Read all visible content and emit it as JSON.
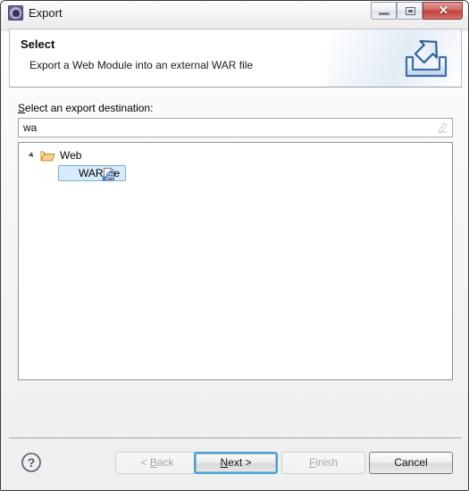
{
  "window": {
    "title": "Export",
    "icon": "eclipse-gear-icon",
    "controls": {
      "minimize": "minimize-icon",
      "maximize": "restore-icon",
      "close": "✕"
    }
  },
  "header": {
    "title": "Select",
    "subtitle": "Export a Web Module into an external WAR file",
    "icon": "export-arrow-icon"
  },
  "form": {
    "destination_label_mnemonic": "S",
    "destination_label_rest": "elect an export destination:",
    "destination_value": "wa",
    "destination_placeholder": "",
    "clear_icon": "clear-field-icon"
  },
  "tree": {
    "nodes": [
      {
        "label": "Web",
        "icon": "open-folder-icon",
        "expanded": true,
        "selected": false
      },
      {
        "label": "WAR file",
        "icon": "war-file-icon",
        "expanded": false,
        "selected": true
      }
    ]
  },
  "footer": {
    "help_icon": "help-question-icon",
    "buttons": [
      {
        "name": "back",
        "label_pre": "< ",
        "mnemonic": "B",
        "label_post": "ack",
        "enabled": false,
        "default": false
      },
      {
        "name": "next",
        "label_pre": "",
        "mnemonic": "N",
        "label_post": "ext >",
        "enabled": true,
        "default": true
      },
      {
        "name": "finish",
        "label_pre": "",
        "mnemonic": "F",
        "label_post": "inish",
        "enabled": false,
        "default": false
      },
      {
        "name": "cancel",
        "label_pre": "",
        "mnemonic": "",
        "label_post": "Cancel",
        "enabled": true,
        "default": false
      }
    ]
  },
  "colors": {
    "accent_focus": "#3aa6e0",
    "selection_bg": "#d6ebfb",
    "selection_border": "#7ab0d8",
    "close_red": "#bf4038",
    "folder_orange": "#e8a33d",
    "app_icon_purple": "#6d5d94"
  }
}
